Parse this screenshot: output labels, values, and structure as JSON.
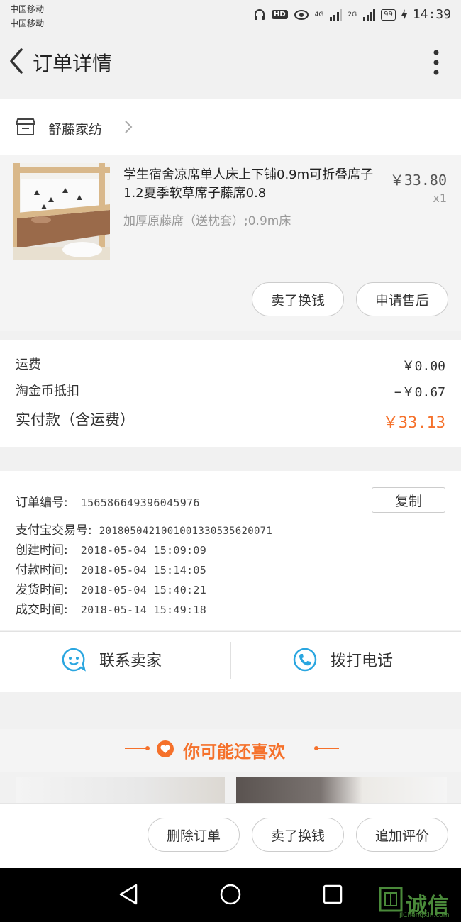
{
  "status_bar": {
    "carrier1": "中国移动",
    "carrier2": "中国移动",
    "hd": "HD",
    "net1": "4G",
    "net2": "2G",
    "battery": "99",
    "time": "14:39"
  },
  "header": {
    "title": "订单详情"
  },
  "shop": {
    "name": "舒藤家纺"
  },
  "product": {
    "name": "学生宿舍凉席单人床上下铺0.9m可折叠席子1.2夏季软草席子藤席0.8",
    "spec": "加厚原藤席（送枕套）;0.9m床",
    "price": "￥33.80",
    "qty": "x1",
    "btn_resell": "卖了换钱",
    "btn_aftersale": "申请售后"
  },
  "fees": {
    "shipping_label": "运费",
    "shipping_value": "￥0.00",
    "coin_label": "淘金币抵扣",
    "coin_value": "−￥0.67",
    "paid_label": "实付款（含运费）",
    "paid_value": "￥33.13"
  },
  "order_info": {
    "copy_label": "复制",
    "rows": [
      {
        "label": "订单编号:",
        "value": "156586649396045976"
      },
      {
        "label": "支付宝交易号:",
        "value": "2018050421001001330535620071"
      },
      {
        "label": "创建时间:",
        "value": "2018-05-04 15:09:09"
      },
      {
        "label": "付款时间:",
        "value": "2018-05-04 15:14:05"
      },
      {
        "label": "发货时间:",
        "value": "2018-05-04 15:40:21"
      },
      {
        "label": "成交时间:",
        "value": "2018-05-14 15:49:18"
      }
    ]
  },
  "contact": {
    "seller": "联系卖家",
    "call": "拨打电话"
  },
  "recommend": {
    "title": "你可能还喜欢"
  },
  "actions": {
    "delete": "删除订单",
    "resell": "卖了换钱",
    "review": "追加评价"
  },
  "watermark": {
    "cn": "诚信",
    "en": "JiChengXin.com"
  },
  "colors": {
    "accent": "#f5712b",
    "blue_icon": "#2aa6e0"
  },
  "icons": [
    "back-icon",
    "more-icon",
    "store-icon",
    "chevron-right-icon",
    "smile-chat-icon",
    "phone-icon",
    "heart-icon",
    "nav-back-icon",
    "nav-home-icon",
    "nav-recent-icon"
  ]
}
